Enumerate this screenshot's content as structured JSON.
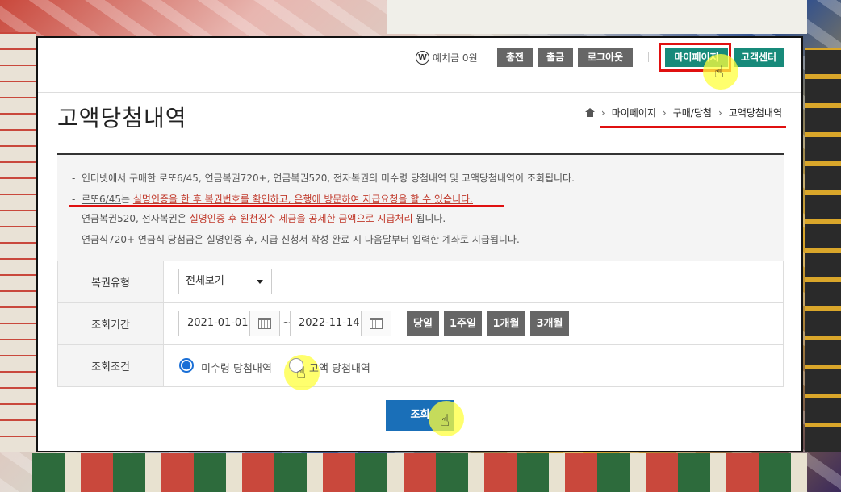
{
  "topbar": {
    "deposit_icon": "W",
    "deposit_text": "예치금 0원",
    "charge": "충전",
    "withdraw": "출금",
    "logout": "로그아웃",
    "mypage": "마이페이지",
    "support": "고객센터"
  },
  "page": {
    "title": "고액당첨내역",
    "breadcrumb": [
      "마이페이지",
      "구매/당첨",
      "고액당첨내역"
    ]
  },
  "info": {
    "line1": "인터넷에서 구매한 로또6/45, 연금복권720+, 연금복권520, 전자복권의 미수령 당첨내역 및 고액당첨내역이 조회됩니다.",
    "line2_a": "로또6/45",
    "line2_b": "는 ",
    "line2_c": "실명인증을 한 후 복권번호를 확인하고, 은행에 방문하여 지급요청을 할 수 있습니다.",
    "line3_a": "연금복권520, 전자복권",
    "line3_b": "은 ",
    "line3_c": "실명인증 후 원천징수 세금을 공제한 금액으로 지급처리",
    "line3_d": " 됩니다.",
    "line4": "연금식720+ 연금식 당첨금은 실명인증 후, 지급 신청서 작성 완료 시 다음달부터 입력한 계좌로 지급됩니다."
  },
  "form": {
    "type_label": "복권유형",
    "type_value": "전체보기",
    "period_label": "조회기간",
    "date_from": "2021-01-01",
    "date_to": "2022-11-14",
    "tilde": "~",
    "quick": [
      "당일",
      "1주일",
      "1개월",
      "3개월"
    ],
    "cond_label": "조회조건",
    "radio1": "미수령 당첨내역",
    "radio2": "고액 당첨내역"
  },
  "search_button": "조회",
  "colors": {
    "accent_green": "#178a7a",
    "search_blue": "#1a6fb8",
    "annotation_red": "#e01010",
    "highlight_yellow": "#ffff3c"
  }
}
